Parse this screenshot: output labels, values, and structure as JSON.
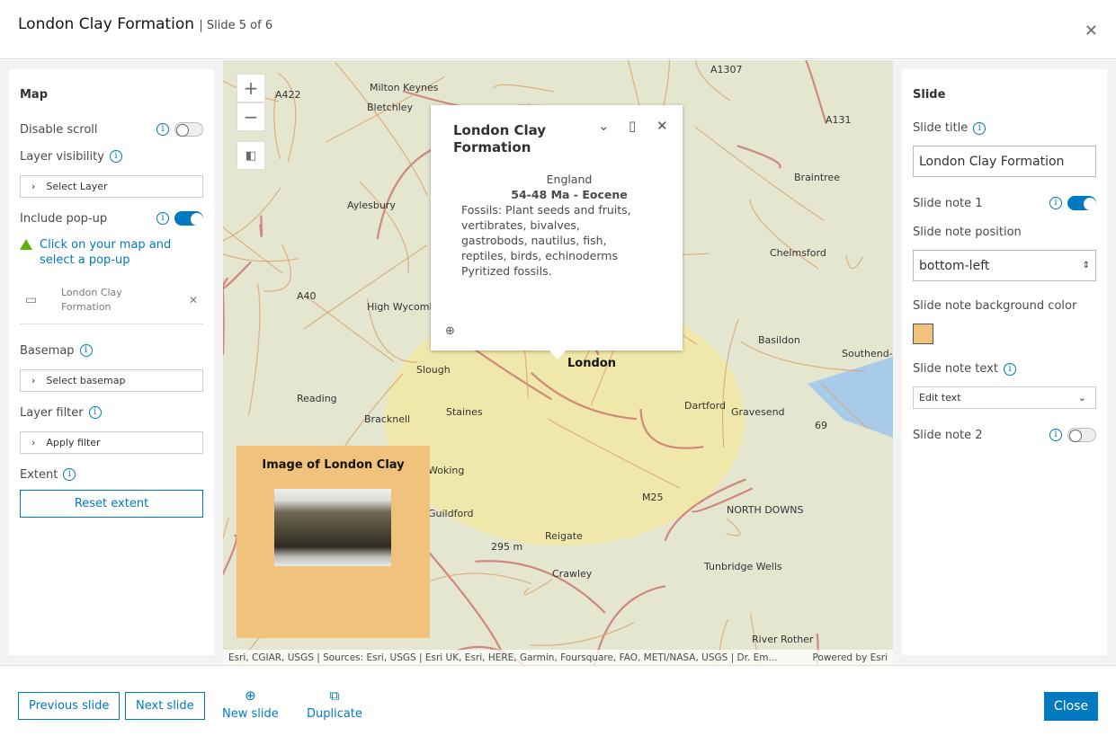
{
  "header": {
    "title": "London Clay Formation",
    "slide_counter": "| Slide 5 of 6",
    "close_icon": "close-icon"
  },
  "left": {
    "heading": "Map",
    "disable_scroll": "Disable scroll",
    "disable_scroll_on": false,
    "layer_visibility": "Layer visibility",
    "select_layer": "Select Layer",
    "include_popup": "Include pop-up",
    "include_popup_on": true,
    "warning": "Click on your map and select a pop-up",
    "popup_item": "London Clay Formation",
    "basemap": "Basemap",
    "select_basemap": "Select basemap",
    "layer_filter": "Layer filter",
    "apply_filter": "Apply filter",
    "extent": "Extent",
    "reset_extent": "Reset extent"
  },
  "map": {
    "popup": {
      "title": "London Clay Formation",
      "region": "England",
      "age": "54-48 Ma - Eocene",
      "fossils": "Fossils: Plant seeds and fruits, vertibrates, bivalves, gastrobods, nautilus, fish, reptiles, birds, echinoderms",
      "note": "Pyritized fossils."
    },
    "note": {
      "title": "Image of London Clay",
      "background": "#f0c27b"
    },
    "labels": [
      "Milton Keynes",
      "Bletchley",
      "Aylesbury",
      "High Wycombe",
      "Slough",
      "Reading",
      "Bracknell",
      "Staines",
      "Woking",
      "Guildford",
      "Reigate",
      "Crawley",
      "295 m",
      "London",
      "Dartford",
      "Gravesend",
      "Basildon",
      "Chelmsford",
      "Braintree",
      "Southend-",
      "Tunbridge Wells",
      "A1307",
      "A131",
      "A422",
      "A40",
      "M25",
      "NORTH DOWNS",
      "69",
      "River Rother"
    ],
    "attribution": "Esri, CGIAR, USGS | Sources: Esri, USGS | Esri UK, Esri, HERE, Garmin, Foursquare, FAO, METI/NASA, USGS | Dr. Em...",
    "powered": "Powered by Esri",
    "zoom_in": "+",
    "zoom_out": "−"
  },
  "right": {
    "heading": "Slide",
    "slide_title_label": "Slide title",
    "slide_title_value": "London Clay Formation",
    "note1": "Slide note 1",
    "note1_on": true,
    "position_label": "Slide note position",
    "position_value": "bottom-left",
    "bg_label": "Slide note background color",
    "bg_color": "#f0c27b",
    "text_label": "Slide note text",
    "edit_text": "Edit text",
    "note2": "Slide note 2",
    "note2_on": false
  },
  "footer": {
    "previous": "Previous slide",
    "next": "Next slide",
    "new_slide": "New slide",
    "duplicate": "Duplicate",
    "close": "Close"
  },
  "colors": {
    "accent": "#0079c1",
    "warning": "#5fb10a"
  }
}
